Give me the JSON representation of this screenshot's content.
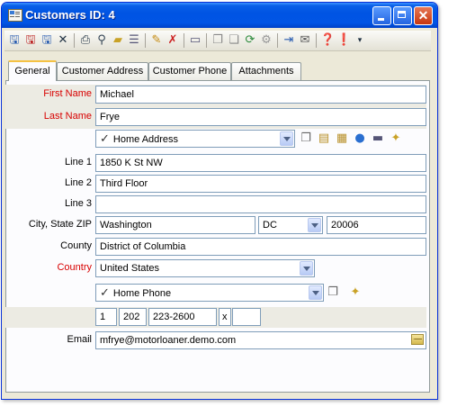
{
  "window": {
    "title": "Customers ID: 4",
    "close_glyph": "✕"
  },
  "toolbar": {
    "icons": [
      "save-icon",
      "save-close-icon",
      "save-new-icon",
      "delete-icon",
      "print-icon",
      "find-icon",
      "open-folder-icon",
      "list-icon",
      "edit-icon",
      "cancel-edit-icon",
      "group-icon",
      "copy-icon",
      "paste-icon",
      "refresh-icon",
      "settings-icon",
      "import-icon",
      "note-icon",
      "help-icon",
      "info-icon",
      "overflow-icon"
    ]
  },
  "tabs": [
    {
      "label": "General"
    },
    {
      "label": "Customer Address"
    },
    {
      "label": "Customer Phone"
    },
    {
      "label": "Attachments"
    }
  ],
  "form": {
    "first_name_label": "First Name",
    "first_name": "Michael",
    "last_name_label": "Last Name",
    "last_name": "Frye",
    "address_type": "Home Address",
    "line1_label": "Line 1",
    "line1": "1850 K St NW",
    "line2_label": "Line 2",
    "line2": "Third Floor",
    "line3_label": "Line 3",
    "line3": "",
    "city_state_zip_label": "City, State ZIP",
    "city": "Washington",
    "state": "DC",
    "zip": "20006",
    "county_label": "County",
    "county": "District of Columbia",
    "country_label": "Country",
    "country": "United States",
    "phone_type": "Home Phone",
    "phone_country": "1",
    "phone_area": "202",
    "phone_number": "223-2600",
    "phone_ext_sep": "x",
    "phone_ext": "",
    "email_label": "Email",
    "email": "mfrye@motorloaner.demo.com"
  },
  "colors": {
    "required_label": "#d80000",
    "title_bar": "#0054e3",
    "window_bg": "#ece9d8"
  }
}
